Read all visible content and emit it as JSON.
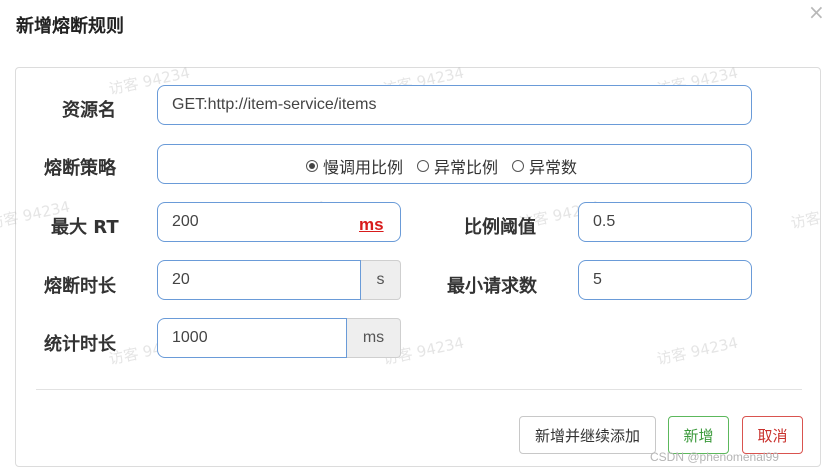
{
  "dialog": {
    "title": "新增熔断规则",
    "close_glyph": "×"
  },
  "watermark": "访客 94234",
  "form": {
    "resource": {
      "label": "资源名",
      "value": "GET:http://item-service/items"
    },
    "strategy": {
      "label": "熔断策略",
      "options": [
        {
          "label": "慢调用比例",
          "checked": true
        },
        {
          "label": "异常比例",
          "checked": false
        },
        {
          "label": "异常数",
          "checked": false
        }
      ]
    },
    "max_rt": {
      "label": "最大 RT",
      "value": "200",
      "unit": "ms"
    },
    "ratio_threshold": {
      "label": "比例阈值",
      "value": "0.5"
    },
    "duration": {
      "label": "熔断时长",
      "value": "20",
      "unit": "s"
    },
    "min_requests": {
      "label": "最小请求数",
      "value": "5"
    },
    "stat_duration": {
      "label": "统计时长",
      "value": "1000",
      "unit": "ms"
    }
  },
  "buttons": {
    "add_continue": "新增并继续添加",
    "add": "新增",
    "cancel": "取消"
  },
  "credit": "CSDN @phenomenal99",
  "colors": {
    "field_border": "#6a9bd8",
    "success": "#5cb85c",
    "danger": "#d9534f",
    "ms_accent": "#d81b1b"
  }
}
